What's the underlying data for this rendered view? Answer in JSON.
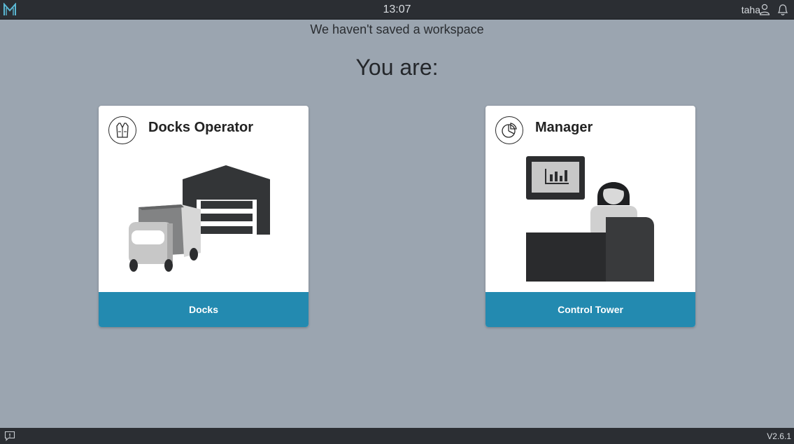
{
  "topbar": {
    "logo": "m-logo-icon",
    "time": "13:07",
    "username": "taha",
    "icons": [
      "user-icon",
      "bell-icon"
    ]
  },
  "main": {
    "notice": "We haven't saved a workspace",
    "prompt": "You are:",
    "roles": [
      {
        "title": "Docks Operator",
        "icon": "safety-vest-icon",
        "illustration": "truck-warehouse",
        "button_label": "Docks"
      },
      {
        "title": "Manager",
        "icon": "pie-chart-icon",
        "illustration": "manager-desk",
        "button_label": "Control Tower"
      }
    ]
  },
  "bottombar": {
    "feedback_icon": "feedback-icon",
    "version": "V2.6.1"
  },
  "colors": {
    "background": "#9ba5b0",
    "bar": "#2b2e33",
    "accent": "#238ab0",
    "card": "#ffffff"
  }
}
